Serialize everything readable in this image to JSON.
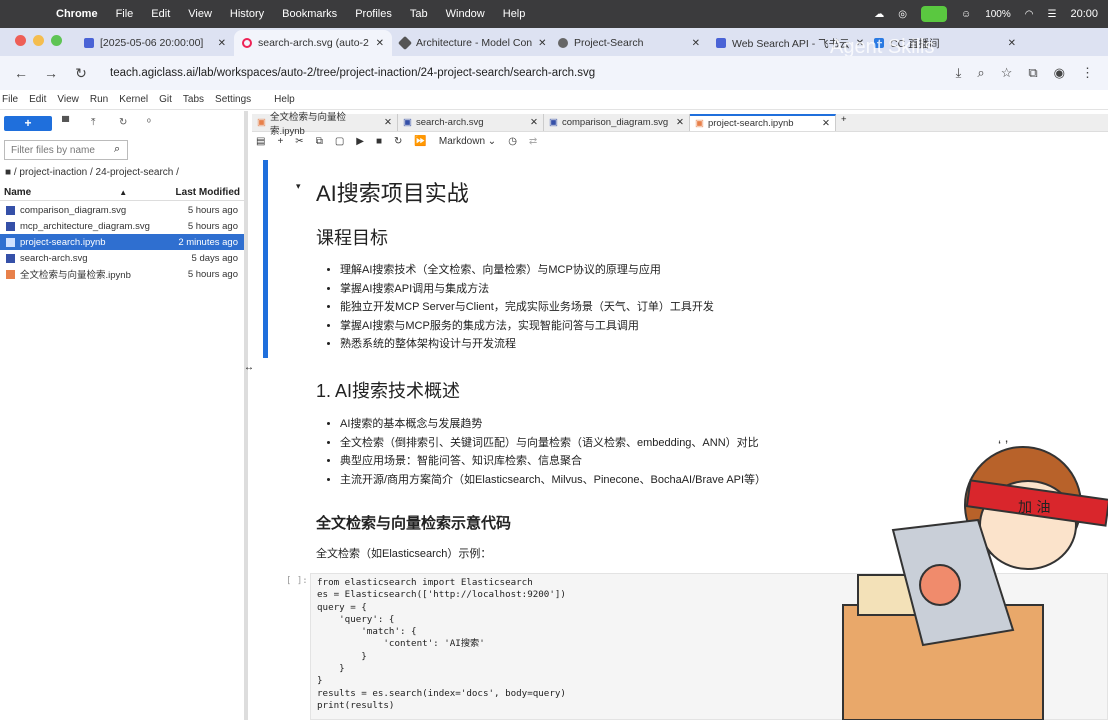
{
  "menubar": {
    "app": "Chrome",
    "items": [
      "File",
      "Edit",
      "View",
      "History",
      "Bookmarks",
      "Profiles",
      "Tab",
      "Window",
      "Help"
    ],
    "battery": "100%",
    "time": "20:00"
  },
  "browser_tabs": [
    {
      "label": "[2025-05-06 20:00:00]",
      "active": false
    },
    {
      "label": "search-arch.svg (auto-2",
      "active": true
    },
    {
      "label": "Architecture - Model Con",
      "active": false
    },
    {
      "label": "Project-Search",
      "active": false
    },
    {
      "label": "Web Search API - 飞书云",
      "active": false
    },
    {
      "label": "CC 直播间",
      "active": false
    }
  ],
  "watermark": "Agent Skills",
  "address": {
    "url": "teach.agiclass.ai/lab/workspaces/auto-2/tree/project-inaction/24-project-search/search-arch.svg"
  },
  "jupyter_menu": [
    "File",
    "Edit",
    "View",
    "Run",
    "Kernel",
    "Git",
    "Tabs",
    "Settings",
    "Help"
  ],
  "filebrowser": {
    "new_label": "+",
    "filter_placeholder": "Filter files by name",
    "breadcrumb": "/ project-inaction / 24-project-search /",
    "col_name": "Name",
    "col_modified": "Last Modified",
    "files": [
      {
        "name": "comparison_diagram.svg",
        "modified": "5 hours ago",
        "selected": false
      },
      {
        "name": "mcp_architecture_diagram.svg",
        "modified": "5 hours ago",
        "selected": false
      },
      {
        "name": "project-search.ipynb",
        "modified": "2 minutes ago",
        "selected": true
      },
      {
        "name": "search-arch.svg",
        "modified": "5 days ago",
        "selected": false
      },
      {
        "name": "全文检索与向量检索.ipynb",
        "modified": "5 hours ago",
        "selected": false
      }
    ]
  },
  "notebook_tabs": [
    {
      "label": "全文检索与向量检索.ipynb"
    },
    {
      "label": "search-arch.svg"
    },
    {
      "label": "comparison_diagram.svg"
    },
    {
      "label": "project-search.ipynb",
      "active": true
    }
  ],
  "toolbar": {
    "cell_type": "Markdown"
  },
  "notebook": {
    "title": "AI搜索项目实战",
    "goals_heading": "课程目标",
    "goals": [
      "理解AI搜索技术（全文检索、向量检索）与MCP协议的原理与应用",
      "掌握AI搜索API调用与集成方法",
      "能独立开发MCP Server与Client，完成实际业务场景（天气、订单）工具开发",
      "掌握AI搜索与MCP服务的集成方法，实现智能问答与工具调用",
      "熟悉系统的整体架构设计与开发流程"
    ],
    "section1": "1. AI搜索技术概述",
    "section1_items": [
      "AI搜索的基本概念与发展趋势",
      "全文检索（倒排索引、关键词匹配）与向量检索（语义检索、embedding、ANN）对比",
      "典型应用场景：智能问答、知识库检索、信息聚合",
      "主流开源/商用方案简介（如Elasticsearch、Milvus、Pinecone、BochaAI/Brave API等）"
    ],
    "code_heading": "全文检索与向量检索示意代码",
    "code_intro": "全文检索（如Elasticsearch）示例：",
    "prompt": "[ ]:",
    "code": "from elasticsearch import Elasticsearch\nes = Elasticsearch(['http://localhost:9200'])\nquery = {\n    'query': {\n        'match': {\n            'content': 'AI搜索'\n        }\n    }\n}\nresults = es.search(index='docs', body=query)\nprint(results)"
  },
  "sticker_text": "加油"
}
